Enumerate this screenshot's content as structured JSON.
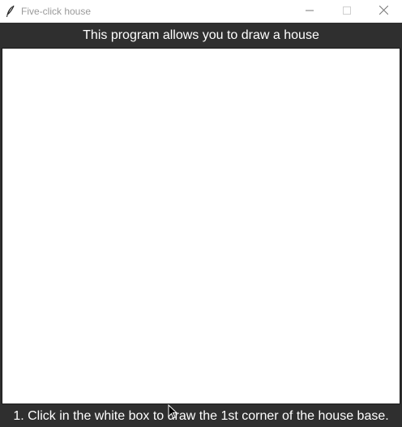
{
  "window": {
    "title": "Five-click house",
    "app_icon": "feather-icon",
    "controls": {
      "minimize_icon": "minimize-icon",
      "maximize_icon": "maximize-icon",
      "close_icon": "close-icon"
    }
  },
  "header": {
    "text": "This program allows you to draw a house"
  },
  "canvas": {
    "background": "#ffffff"
  },
  "status": {
    "text": "1. Click in the white box to draw the 1st corner of the house base."
  },
  "colors": {
    "chrome_background": "#2f2f2f",
    "label_text": "#ffffff"
  }
}
